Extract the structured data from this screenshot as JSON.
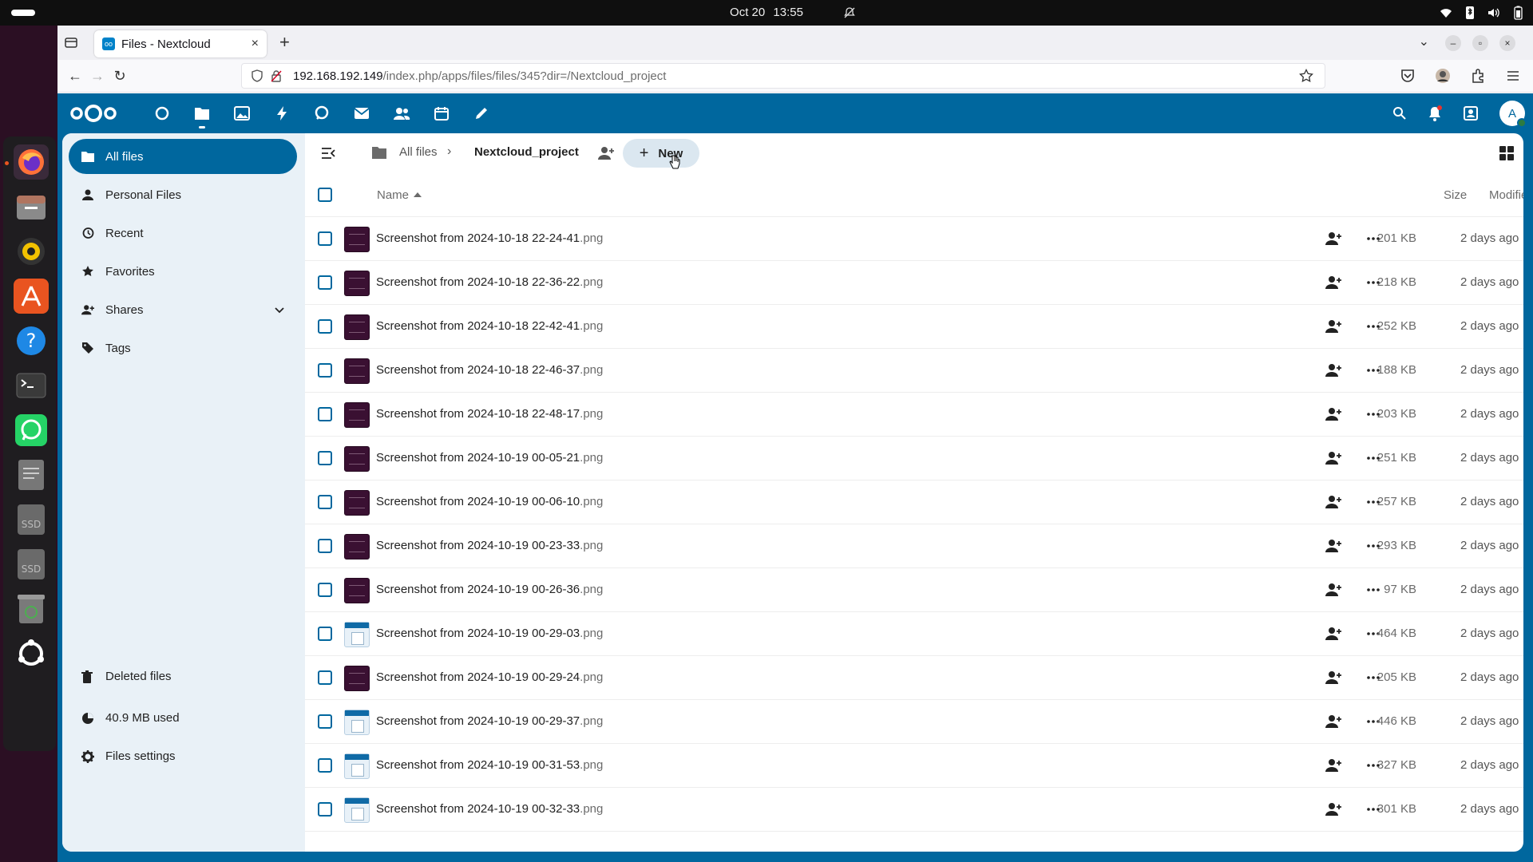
{
  "system": {
    "date": "Oct 20",
    "time": "13:55"
  },
  "browser": {
    "tab_title": "Files - Nextcloud",
    "url_host": "192.168.192.149",
    "url_path": "/index.php/apps/files/files/345?dir=/Nextcloud_project",
    "tab_close": "×",
    "new_tab": "+",
    "tab_dropdown": "⌄"
  },
  "sidebar": {
    "items": [
      {
        "label": "All files",
        "icon": "folder-icon"
      },
      {
        "label": "Personal Files",
        "icon": "person-icon"
      },
      {
        "label": "Recent",
        "icon": "history-icon"
      },
      {
        "label": "Favorites",
        "icon": "star-icon"
      },
      {
        "label": "Shares",
        "icon": "share-icon"
      },
      {
        "label": "Tags",
        "icon": "tag-icon"
      }
    ],
    "deleted": "Deleted files",
    "quota": "40.9 MB used",
    "settings": "Files settings"
  },
  "breadcrumb": {
    "root": "All files",
    "current": "Nextcloud_project",
    "separator": "›"
  },
  "toolbar": {
    "new_label": "New",
    "new_plus": "+"
  },
  "table": {
    "headers": {
      "name": "Name",
      "size": "Size",
      "modified": "Modified"
    },
    "rows": [
      {
        "name": "Screenshot from 2024-10-18 22-24-41",
        "ext": ".png",
        "size": "201 KB",
        "modified": "2 days ago",
        "thumb": "dark"
      },
      {
        "name": "Screenshot from 2024-10-18 22-36-22",
        "ext": ".png",
        "size": "218 KB",
        "modified": "2 days ago",
        "thumb": "dark"
      },
      {
        "name": "Screenshot from 2024-10-18 22-42-41",
        "ext": ".png",
        "size": "252 KB",
        "modified": "2 days ago",
        "thumb": "dark"
      },
      {
        "name": "Screenshot from 2024-10-18 22-46-37",
        "ext": ".png",
        "size": "188 KB",
        "modified": "2 days ago",
        "thumb": "dark"
      },
      {
        "name": "Screenshot from 2024-10-18 22-48-17",
        "ext": ".png",
        "size": "203 KB",
        "modified": "2 days ago",
        "thumb": "dark"
      },
      {
        "name": "Screenshot from 2024-10-19 00-05-21",
        "ext": ".png",
        "size": "251 KB",
        "modified": "2 days ago",
        "thumb": "dark"
      },
      {
        "name": "Screenshot from 2024-10-19 00-06-10",
        "ext": ".png",
        "size": "257 KB",
        "modified": "2 days ago",
        "thumb": "dark"
      },
      {
        "name": "Screenshot from 2024-10-19 00-23-33",
        "ext": ".png",
        "size": "293 KB",
        "modified": "2 days ago",
        "thumb": "dark"
      },
      {
        "name": "Screenshot from 2024-10-19 00-26-36",
        "ext": ".png",
        "size": "97 KB",
        "modified": "2 days ago",
        "thumb": "dark"
      },
      {
        "name": "Screenshot from 2024-10-19 00-29-03",
        "ext": ".png",
        "size": "464 KB",
        "modified": "2 days ago",
        "thumb": "light"
      },
      {
        "name": "Screenshot from 2024-10-19 00-29-24",
        "ext": ".png",
        "size": "205 KB",
        "modified": "2 days ago",
        "thumb": "dark"
      },
      {
        "name": "Screenshot from 2024-10-19 00-29-37",
        "ext": ".png",
        "size": "446 KB",
        "modified": "2 days ago",
        "thumb": "light"
      },
      {
        "name": "Screenshot from 2024-10-19 00-31-53",
        "ext": ".png",
        "size": "327 KB",
        "modified": "2 days ago",
        "thumb": "light"
      },
      {
        "name": "Screenshot from 2024-10-19 00-32-33",
        "ext": ".png",
        "size": "301 KB",
        "modified": "2 days ago",
        "thumb": "light"
      }
    ]
  },
  "colors": {
    "primary": "#00679e",
    "sidebar_bg": "#e9f1f7"
  }
}
